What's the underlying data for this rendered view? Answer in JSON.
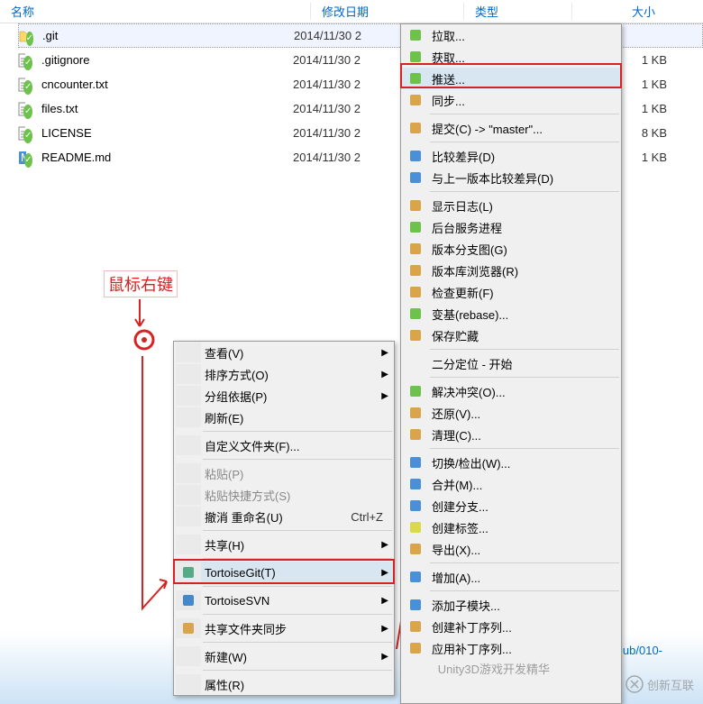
{
  "columns": {
    "name": "名称",
    "date": "修改日期",
    "type": "类型",
    "size": "大小"
  },
  "files": [
    {
      "name": ".git",
      "date": "2014/11/30 2",
      "size": "",
      "icon": "folder"
    },
    {
      "name": ".gitignore",
      "date": "2014/11/30 2",
      "size": "1 KB",
      "icon": "txt"
    },
    {
      "name": "cncounter.txt",
      "date": "2014/11/30 2",
      "size": "1 KB",
      "icon": "txt"
    },
    {
      "name": "files.txt",
      "date": "2014/11/30 2",
      "size": "1 KB",
      "icon": "txt"
    },
    {
      "name": "LICENSE",
      "date": "2014/11/30 2",
      "size": "8 KB",
      "icon": "txt"
    },
    {
      "name": "README.md",
      "date": "2014/11/30 2",
      "size": "1 KB",
      "icon": "md"
    }
  ],
  "annotation": {
    "label": "鼠标右键"
  },
  "menu1": {
    "items": [
      {
        "label": "查看(V)",
        "sub": true
      },
      {
        "label": "排序方式(O)",
        "sub": true
      },
      {
        "label": "分组依据(P)",
        "sub": true
      },
      {
        "label": "刷新(E)"
      },
      {
        "sep": true
      },
      {
        "label": "自定义文件夹(F)..."
      },
      {
        "sep": true
      },
      {
        "label": "粘贴(P)",
        "disabled": true
      },
      {
        "label": "粘贴快捷方式(S)",
        "disabled": true
      },
      {
        "label": "撤消 重命名(U)",
        "shortcut": "Ctrl+Z"
      },
      {
        "sep": true
      },
      {
        "label": "共享(H)",
        "sub": true
      },
      {
        "sep": true
      },
      {
        "label": "TortoiseGit(T)",
        "sub": true,
        "icon": "tgit",
        "hl": true
      },
      {
        "sep": true
      },
      {
        "label": "TortoiseSVN",
        "sub": true,
        "icon": "tsvn"
      },
      {
        "sep": true
      },
      {
        "label": "共享文件夹同步",
        "sub": true,
        "icon": "sync"
      },
      {
        "sep": true
      },
      {
        "label": "新建(W)",
        "sub": true
      },
      {
        "sep": true
      },
      {
        "label": "属性(R)"
      }
    ]
  },
  "menu2": {
    "items": [
      {
        "label": "拉取...",
        "icon": "pull"
      },
      {
        "label": "获取...",
        "icon": "fetch"
      },
      {
        "label": "推送...",
        "icon": "push",
        "hl": true
      },
      {
        "label": "同步...",
        "icon": "sync2"
      },
      {
        "sep": true
      },
      {
        "label": "提交(C) -> \"master\"...",
        "icon": "commit"
      },
      {
        "sep": true
      },
      {
        "label": "比较差异(D)",
        "icon": "diff"
      },
      {
        "label": "与上一版本比较差异(D)",
        "icon": "diff2"
      },
      {
        "sep": true
      },
      {
        "label": "显示日志(L)",
        "icon": "log"
      },
      {
        "label": "后台服务进程",
        "icon": "daemon"
      },
      {
        "label": "版本分支图(G)",
        "icon": "graph"
      },
      {
        "label": "版本库浏览器(R)",
        "icon": "repo"
      },
      {
        "label": "检查更新(F)",
        "icon": "check"
      },
      {
        "label": "变基(rebase)...",
        "icon": "rebase"
      },
      {
        "label": "保存贮藏",
        "icon": "stash"
      },
      {
        "sep": true
      },
      {
        "label": "二分定位 - 开始"
      },
      {
        "sep": true
      },
      {
        "label": "解决冲突(O)...",
        "icon": "resolve"
      },
      {
        "label": "还原(V)...",
        "icon": "revert"
      },
      {
        "label": "清理(C)...",
        "icon": "clean"
      },
      {
        "sep": true
      },
      {
        "label": "切换/检出(W)...",
        "icon": "switch"
      },
      {
        "label": "合并(M)...",
        "icon": "merge"
      },
      {
        "label": "创建分支...",
        "icon": "branch"
      },
      {
        "label": "创建标签...",
        "icon": "tag"
      },
      {
        "label": "导出(X)...",
        "icon": "export"
      },
      {
        "sep": true
      },
      {
        "label": "增加(A)...",
        "icon": "add"
      },
      {
        "sep": true
      },
      {
        "label": "添加子模块...",
        "icon": "submod"
      },
      {
        "label": "创建补丁序列...",
        "icon": "patch"
      },
      {
        "label": "应用补丁序列...",
        "icon": "apply"
      }
    ]
  },
  "watermark": {
    "wechat": "Unity3D游戏开发精华",
    "brand": "创新互联"
  },
  "path": "ub/010-"
}
